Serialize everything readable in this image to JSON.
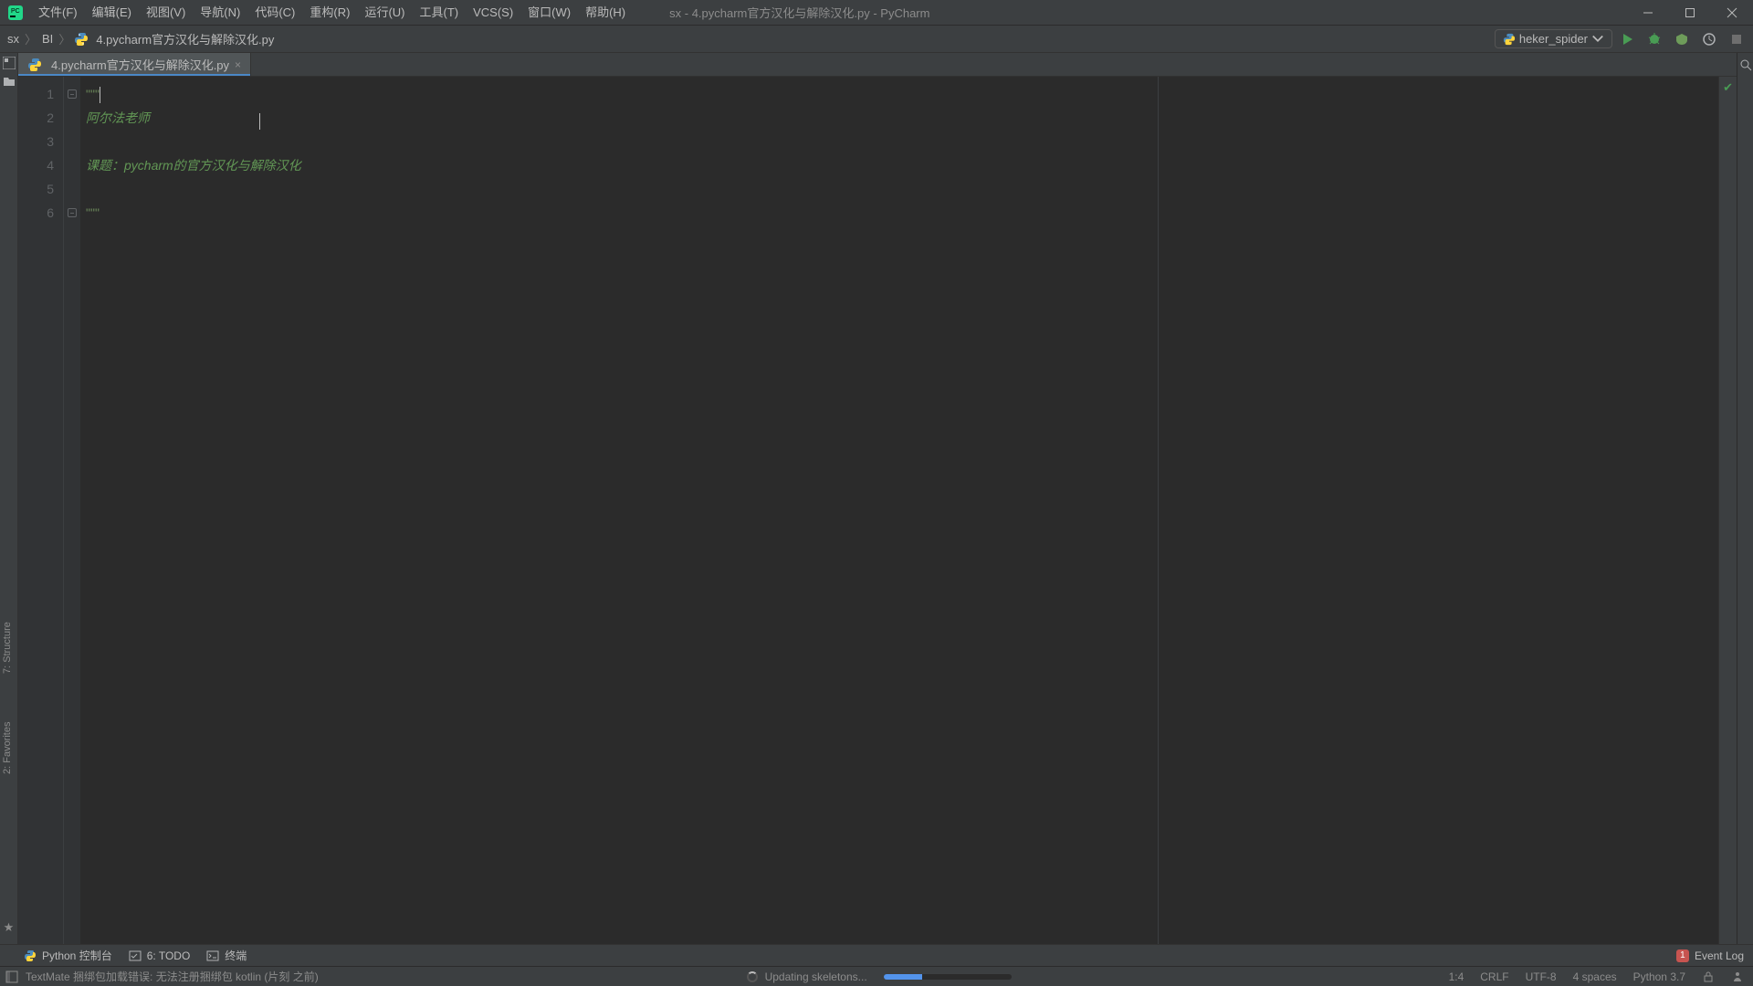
{
  "window": {
    "title": "sx - 4.pycharm官方汉化与解除汉化.py - PyCharm"
  },
  "menu": {
    "file": "文件(F)",
    "edit": "编辑(E)",
    "view": "视图(V)",
    "nav": "导航(N)",
    "code": "代码(C)",
    "refac": "重构(R)",
    "run": "运行(U)",
    "tools": "工具(T)",
    "vcs": "VCS(S)",
    "window": "窗口(W)",
    "help": "帮助(H)"
  },
  "breadcrumb": {
    "root": "sx",
    "folder": "BI",
    "file": "4.pycharm官方汉化与解除汉化.py"
  },
  "run_config": {
    "name": "heker_spider"
  },
  "tab": {
    "name": "4.pycharm官方汉化与解除汉化.py"
  },
  "editor": {
    "lines": [
      "1",
      "2",
      "3",
      "4",
      "5",
      "6"
    ],
    "l1": "\"\"\"",
    "l2": "阿尔法老师",
    "l3": "",
    "l4": "课题：pycharm的官方汉化与解除汉化",
    "l5": "",
    "l6": "\"\"\""
  },
  "left_tool": {
    "project": "1: 项目",
    "structure": "7: Structure",
    "favorites": "2: Favorites"
  },
  "bottom_tools": {
    "console": "Python 控制台",
    "todo": "6: TODO",
    "terminal": "终端"
  },
  "event_log": {
    "count": "1",
    "label": "Event Log"
  },
  "status": {
    "message": "TextMate 捆绑包加载错误: 无法注册捆绑包 kotlin (片刻 之前)",
    "bg_task": "Updating skeletons...",
    "position": "1:4",
    "line_sep": "CRLF",
    "encoding": "UTF-8",
    "indent": "4 spaces",
    "interpreter": "Python 3.7"
  }
}
